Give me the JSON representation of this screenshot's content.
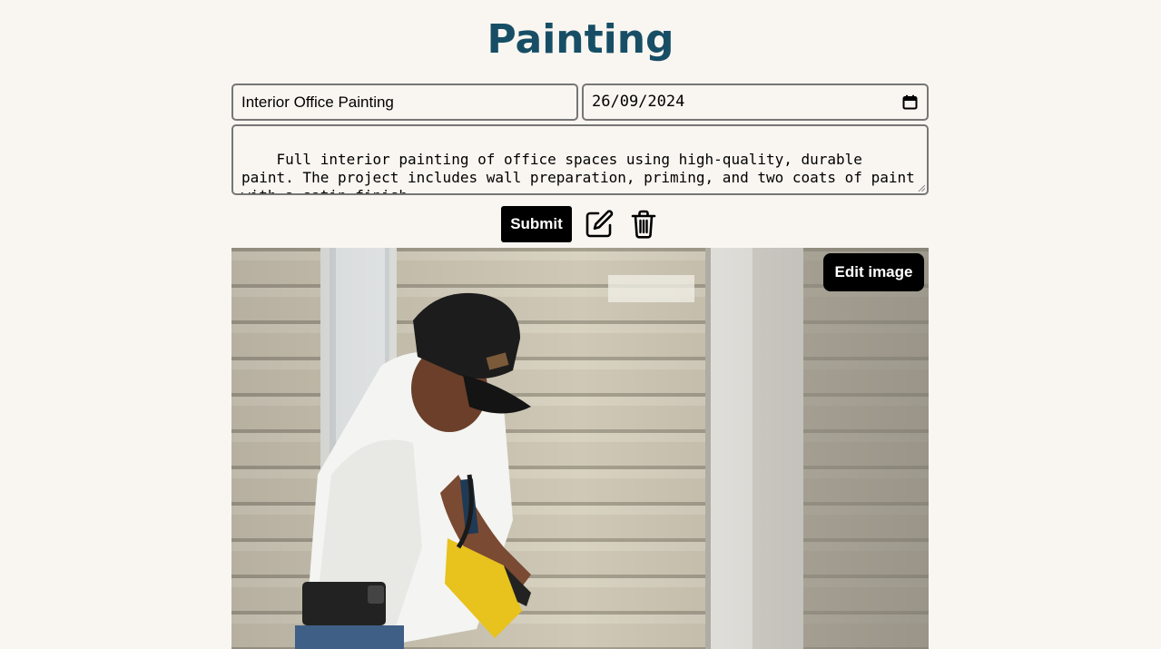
{
  "page": {
    "title": "Painting"
  },
  "form": {
    "title_value": "Interior Office Painting",
    "date_value": "26/09/2024",
    "description_value": "Full interior painting of office spaces using high-quality, durable paint. The project includes wall preparation, priming, and two coats of paint with a satin finish.",
    "submit_label": "Submit"
  },
  "actions": {
    "edit_icon": "edit-icon",
    "delete_icon": "trash-icon"
  },
  "image": {
    "edit_label": "Edit image",
    "alt": "Painter applying paint to exterior siding"
  },
  "colors": {
    "title": "#174e66",
    "background": "#f9f6f1",
    "button": "#000000"
  }
}
